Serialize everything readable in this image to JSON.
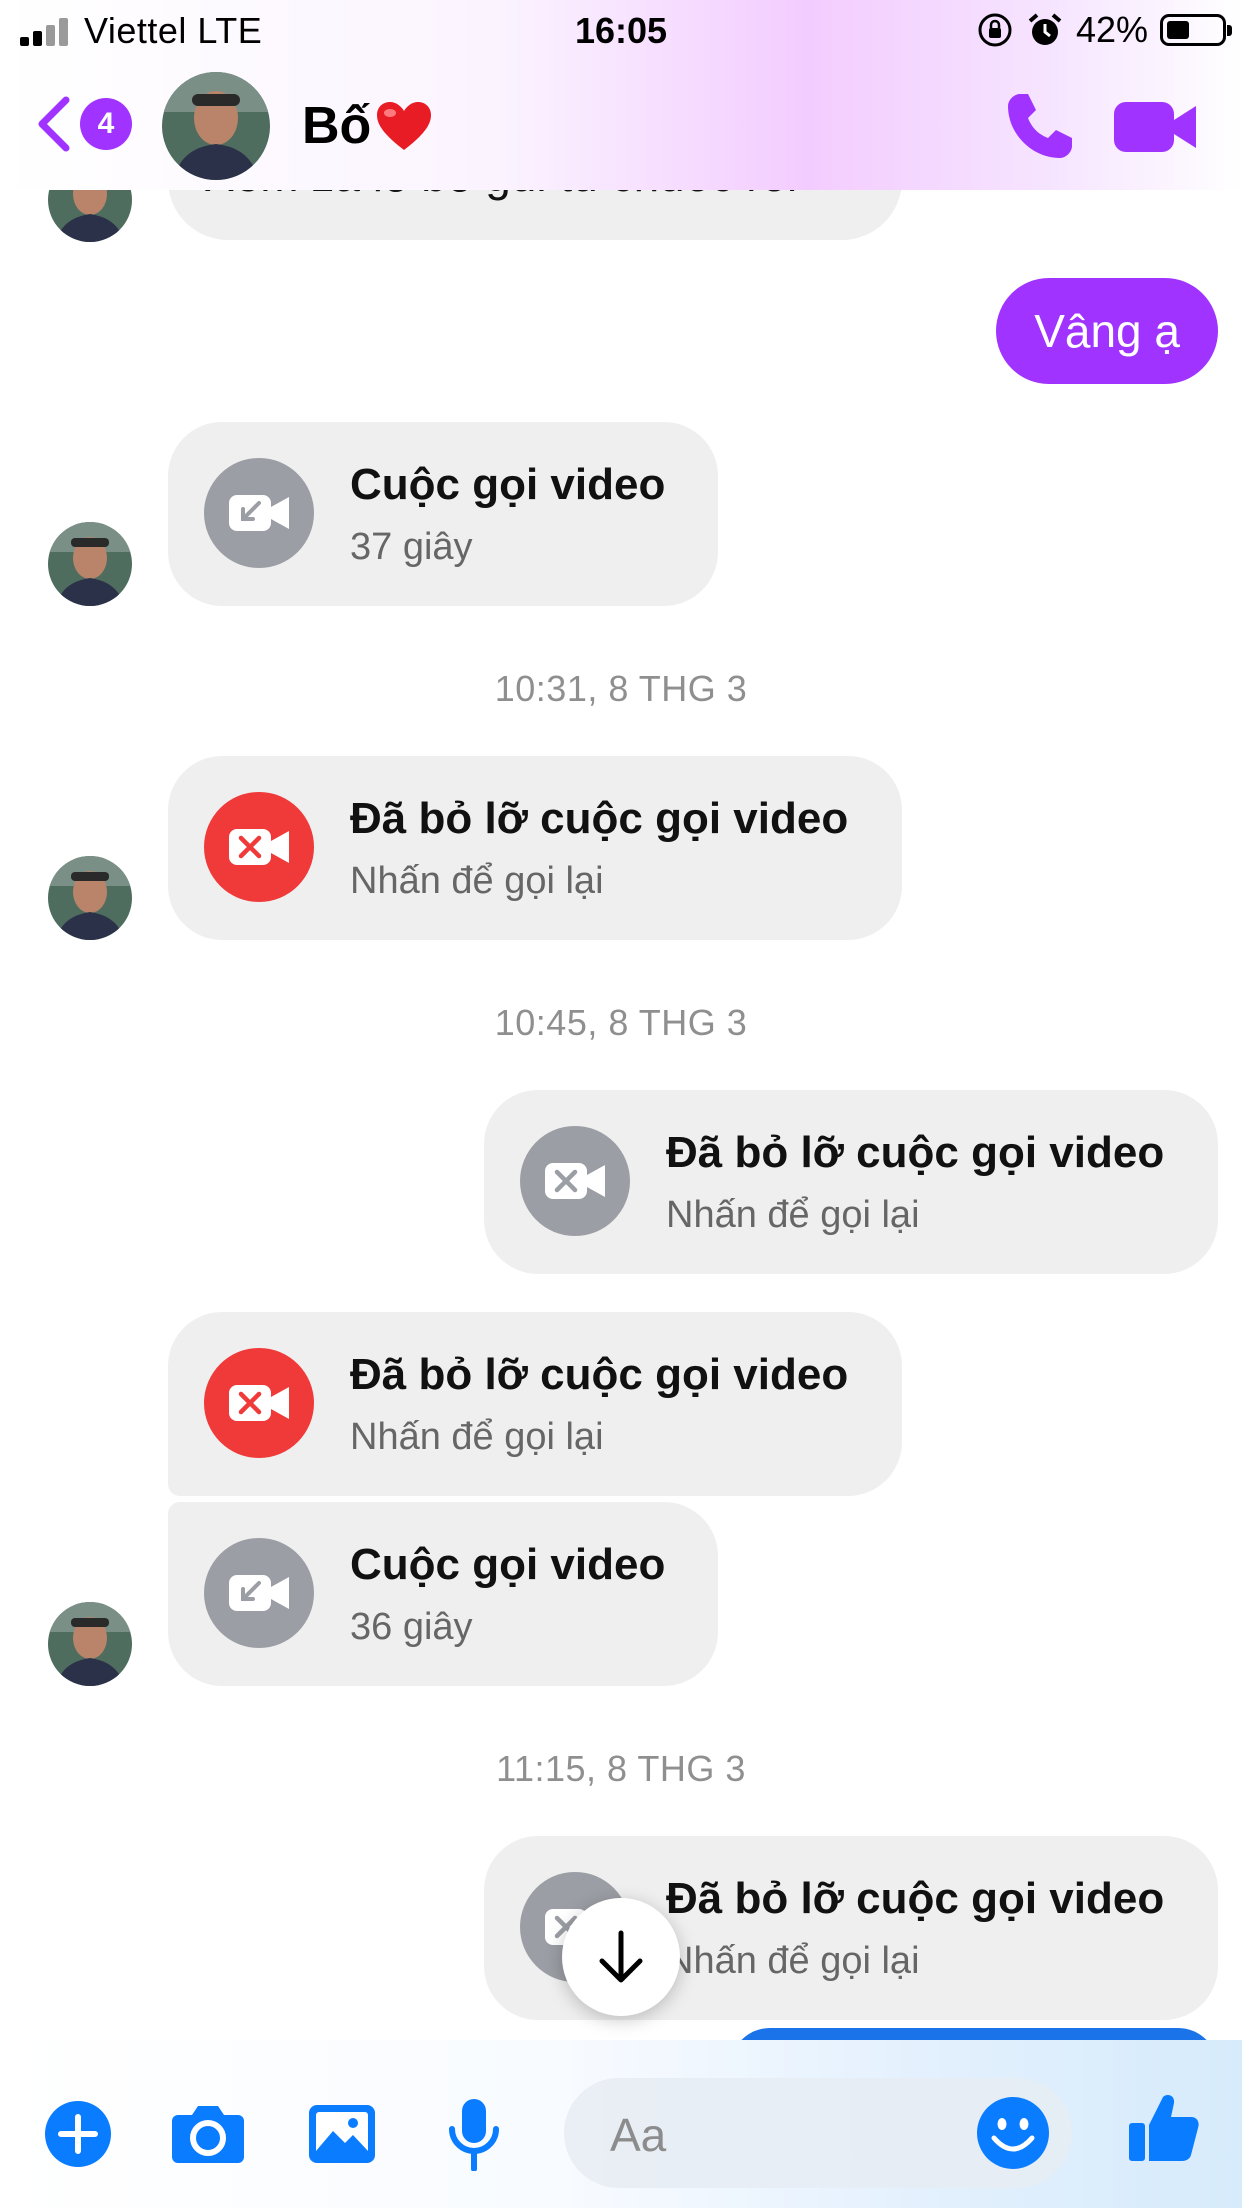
{
  "status_bar": {
    "carrier": "Viettel   LTE",
    "time": "16:05",
    "battery_text": "42%",
    "battery_level": 0.42
  },
  "header": {
    "back_badge_count": "4",
    "contact_name": "Bố",
    "accent_color": "#a033ff"
  },
  "conversation": {
    "partial_message": "Xem za lô bô gui tu chuoc roi",
    "sent_text": "Vâng ạ",
    "items": [
      {
        "type": "call",
        "title": "Cuộc gọi video",
        "subtitle": "37 giây"
      },
      {
        "type": "timestamp",
        "text": "10:31, 8 THG 3"
      },
      {
        "type": "missed_call",
        "title": "Đã bỏ lỡ cuộc gọi video",
        "subtitle": "Nhấn để gọi lại"
      },
      {
        "type": "timestamp",
        "text": "10:45, 8 THG 3"
      },
      {
        "type": "missed_call",
        "title": "Đã bỏ lỡ cuộc gọi video",
        "subtitle": "Nhấn để gọi lại"
      },
      {
        "type": "missed_call",
        "title": "Đã bỏ lỡ cuộc gọi video",
        "subtitle": "Nhấn để gọi lại"
      },
      {
        "type": "call",
        "title": "Cuộc gọi video",
        "subtitle": "36 giây"
      },
      {
        "type": "timestamp",
        "text": "11:15, 8 THG 3"
      },
      {
        "type": "missed_call",
        "title": "Đã bỏ lỡ cuộc gọi video",
        "subtitle": "Nhấn để gọi lại"
      }
    ]
  },
  "composer": {
    "placeholder": "Aa",
    "icons": [
      "plus-icon",
      "camera-icon",
      "image-icon",
      "microphone-icon",
      "emoji-icon",
      "thumbs-up-icon"
    ],
    "icon_color": "#0a7cff"
  }
}
